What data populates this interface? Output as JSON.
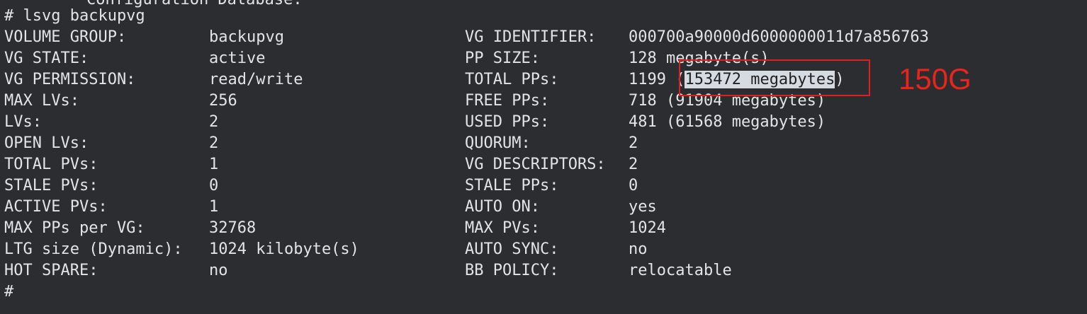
{
  "terminal": {
    "previous_output": "Configuration Database.",
    "command_line": "# lsvg backupvg",
    "final_prompt": "#",
    "selection_color": "#d6dbe2",
    "rows": [
      {
        "left_label": "VOLUME GROUP:",
        "left_value": "backupvg",
        "right_label": "VG IDENTIFIER:",
        "right_value": "000700a90000d6000000011d7a856763"
      },
      {
        "left_label": "VG STATE:",
        "left_value": "active",
        "right_label": "PP SIZE:",
        "right_value": "128 megabyte(s)"
      },
      {
        "left_label": "VG PERMISSION:",
        "left_value": "read/write",
        "right_label": "TOTAL PPs:",
        "right_value": "1199 (153472 megabytes)"
      },
      {
        "left_label": "MAX LVs:",
        "left_value": "256",
        "right_label": "FREE PPs:",
        "right_value": "718 (91904 megabytes)"
      },
      {
        "left_label": "LVs:",
        "left_value": "2",
        "right_label": "USED PPs:",
        "right_value": "481 (61568 megabytes)"
      },
      {
        "left_label": "OPEN LVs:",
        "left_value": "2",
        "right_label": "QUORUM:",
        "right_value": "2"
      },
      {
        "left_label": "TOTAL PVs:",
        "left_value": "1",
        "right_label": "VG DESCRIPTORS:",
        "right_value": "2"
      },
      {
        "left_label": "STALE PVs:",
        "left_value": "0",
        "right_label": "STALE PPs:",
        "right_value": "0"
      },
      {
        "left_label": "ACTIVE PVs:",
        "left_value": "1",
        "right_label": "AUTO ON:",
        "right_value": "yes"
      },
      {
        "left_label": "MAX PPs per VG:",
        "left_value": "32768",
        "right_label": "MAX PVs:",
        "right_value": "1024"
      },
      {
        "left_label": "LTG size (Dynamic):",
        "left_value": "1024 kilobyte(s)",
        "right_label": "AUTO SYNC:",
        "right_value": "no"
      },
      {
        "left_label": "HOT SPARE:",
        "left_value": "no",
        "right_label": "BB POLICY:",
        "right_value": "relocatable"
      }
    ],
    "total_pps_parts": {
      "prefix": "1199 (",
      "highlighted": "153472 megabytes",
      "suffix": ")"
    }
  },
  "annotation": {
    "text": "150G",
    "color": "#e8241c"
  }
}
